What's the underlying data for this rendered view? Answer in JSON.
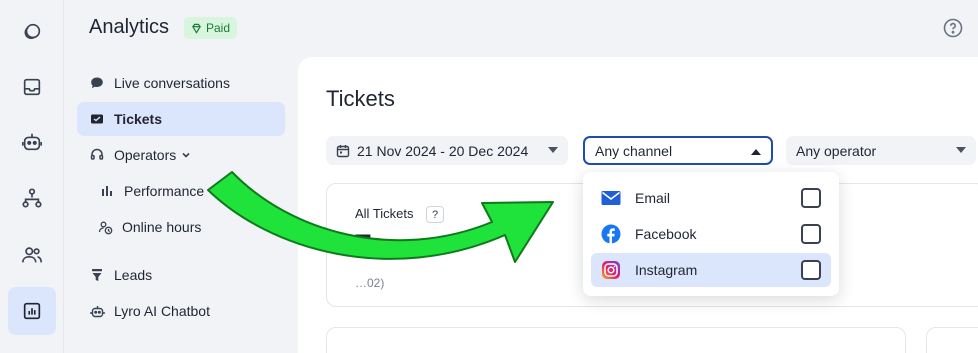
{
  "app": {
    "title": "Analytics",
    "badge": "Paid"
  },
  "rail": {
    "items": [
      {
        "name": "chat-bubbles-icon"
      },
      {
        "name": "inbox-icon"
      },
      {
        "name": "bot-icon"
      },
      {
        "name": "flow-icon"
      },
      {
        "name": "users-icon"
      },
      {
        "name": "analytics-icon",
        "active": true
      }
    ]
  },
  "nav": {
    "live_conversations": "Live conversations",
    "tickets": "Tickets",
    "operators": "Operators",
    "performance": "Performance",
    "online_hours": "Online hours",
    "leads": "Leads",
    "lyro": "Lyro AI Chatbot"
  },
  "main": {
    "title": "Tickets",
    "filters": {
      "date_range": "21 Nov 2024 - 20 Dec 2024",
      "channel": "Any channel",
      "operator": "Any operator"
    },
    "card": {
      "title": "All Tickets",
      "help": "?",
      "value": "7",
      "sub": "…02)"
    }
  },
  "dropdown": {
    "items": [
      {
        "label": "Email",
        "icon": "email-icon",
        "checked": false
      },
      {
        "label": "Facebook",
        "icon": "facebook-icon",
        "checked": false
      },
      {
        "label": "Instagram",
        "icon": "instagram-icon",
        "checked": false,
        "highlighted": true
      }
    ]
  },
  "colors": {
    "accent": "#1f4ea8",
    "active_bg": "#dbe5fb",
    "arrow": "#1fe23a",
    "badge_bg": "#d8f5de"
  }
}
